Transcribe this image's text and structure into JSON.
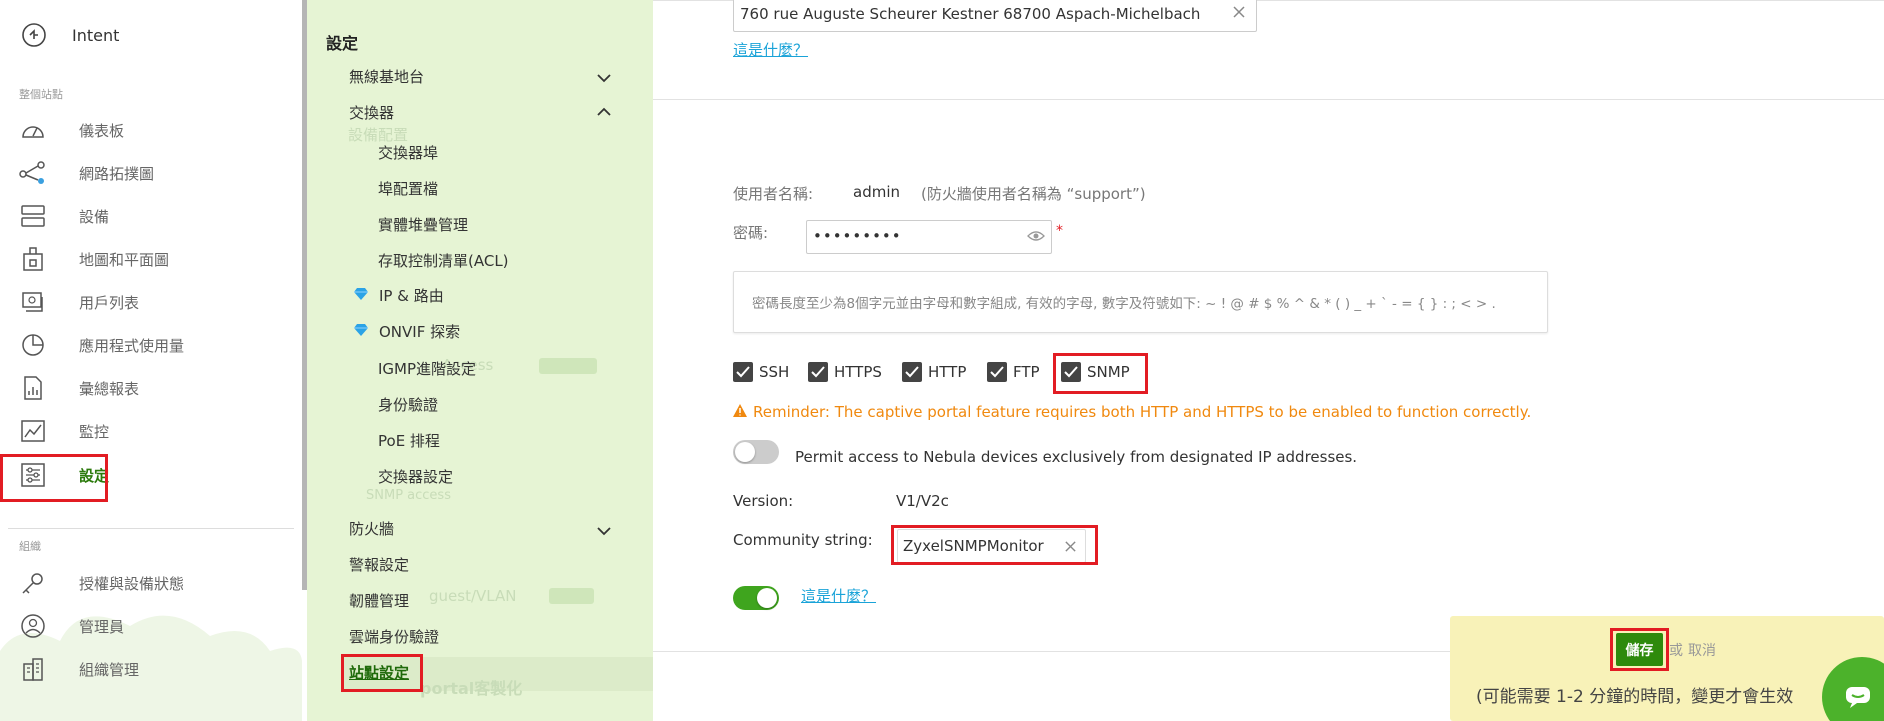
{
  "left_nav": {
    "intent_label": "Intent",
    "section_site": "整個站點",
    "items": [
      {
        "label": "儀表板",
        "icon": "dashboard-icon"
      },
      {
        "label": "網路拓撲圖",
        "icon": "topology-icon"
      },
      {
        "label": "設備",
        "icon": "devices-icon"
      },
      {
        "label": "地圖和平面圖",
        "icon": "map-icon"
      },
      {
        "label": "用戶列表",
        "icon": "client-list-icon"
      },
      {
        "label": "應用程式使用量",
        "icon": "pie-chart-icon"
      },
      {
        "label": "彙總報表",
        "icon": "report-icon"
      },
      {
        "label": "監控",
        "icon": "monitor-icon"
      },
      {
        "label": "設定",
        "icon": "settings-icon"
      }
    ],
    "section_org": "組織",
    "org_items": [
      {
        "label": "授權與設備狀態",
        "icon": "license-key-icon"
      },
      {
        "label": "管理員",
        "icon": "admin-icon"
      },
      {
        "label": "組織管理",
        "icon": "building-icon"
      }
    ]
  },
  "submenu": {
    "title": "設定",
    "l1_wireless": "無線基地台",
    "l1_switch": "交換器",
    "switch_children": [
      "交換器埠",
      "埠配置檔",
      "實體堆疊管理",
      "存取控制清單(ACL)",
      "IP & 路由",
      "ONVIF 探索",
      "IGMP進階設定",
      "身份驗證",
      "PoE 排程",
      "交換器設定"
    ],
    "l1_firewall": "防火牆",
    "l1_alerts": "警報設定",
    "l1_firmware": "韌體管理",
    "l1_cloud_auth": "雲端身份驗證",
    "l1_site_settings": "站點設定",
    "ghost_texts": {
      "g1": "設備配置",
      "g2": "Access",
      "g3": "SNMP access",
      "g4": "guest/VLAN",
      "g5": "portal客製化"
    }
  },
  "main": {
    "address_value": "760 rue Auguste Scheurer Kestner 68700 Aspach-Michelbach",
    "whats_this_1": "這是什麼？",
    "username_label": "使用者名稱:",
    "username_value": "admin",
    "username_note": "(防火牆使用者名稱為 “support”)",
    "password_label": "密碼:",
    "password_value": "•••••••••",
    "required_mark": "*",
    "password_hint": "密碼長度至少為8個字元並由字母和數字組成, 有效的字母, 數字及符號如下: ~ ! @ # $ % ^ & * ( ) _ + ` - = { } : ; < > .",
    "protocols": [
      "SSH",
      "HTTPS",
      "HTTP",
      "FTP",
      "SNMP"
    ],
    "reminder": "Reminder: The captive portal feature requires both HTTP and HTTPS to be enabled to function correctly.",
    "permit_label": "Permit access to Nebula devices exclusively from designated IP addresses.",
    "version_label": "Version:",
    "version_value": "V1/V2c",
    "community_label": "Community string:",
    "community_value": "ZyxelSNMPMonitor",
    "whats_this_2": "這是什麼？",
    "save_label": "儲存",
    "or_label": "或",
    "cancel_label": "取消",
    "save_note": "(可能需要 1-2 分鐘的時間，變更才會生效"
  },
  "colors": {
    "accent_green": "#2e8a0c",
    "highlight_red": "#e21c23",
    "submenu_bg": "#e6f4d4",
    "warning_orange": "#f0890f",
    "link_blue": "#1aa3d8"
  }
}
